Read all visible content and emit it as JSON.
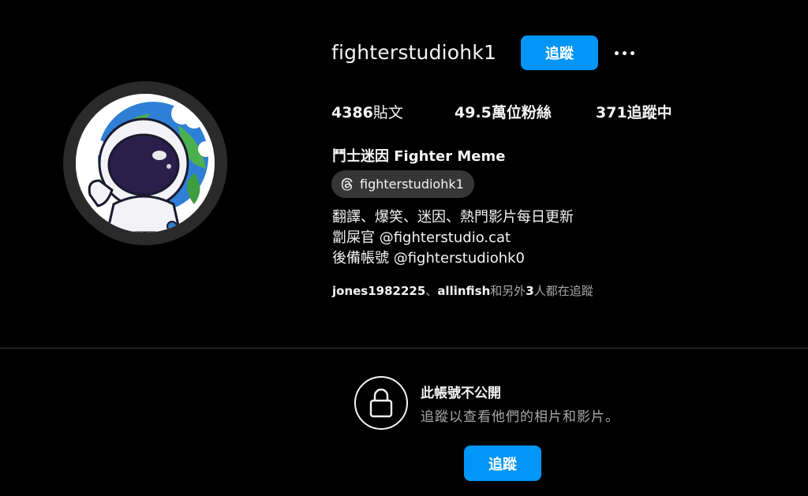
{
  "profile": {
    "username": "fighterstudiohk1",
    "follow_label": "追蹤",
    "more_icon": "more-horizontal-icon",
    "stats": {
      "posts_count": "4386",
      "posts_label": "貼文",
      "followers_count": "49.5萬位",
      "followers_label": "粉絲",
      "following_count": "371",
      "following_label": "追蹤中"
    },
    "full_name": "鬥士迷因 Fighter Meme",
    "threads": {
      "icon": "threads-icon",
      "handle": "fighterstudiohk1"
    },
    "bio": [
      "翻譯、爆笑、迷因、熱門影片每日更新",
      "劏屎官 @fighterstudio.cat",
      "後備帳號 @fighterstudiohk0"
    ],
    "followed_by": {
      "user1": "jones1982225",
      "separator": "、",
      "user2": "allinfish",
      "prefix": "和另外",
      "count": "3",
      "suffix": "人都在追蹤"
    }
  },
  "private": {
    "icon": "lock-icon",
    "title": "此帳號不公開",
    "subtitle": "追蹤以查看他們的相片和影片。",
    "follow_label": "追蹤"
  },
  "colors": {
    "background": "#000000",
    "accent": "#0095f6",
    "text": "#f5f5f5",
    "secondary_text": "#a8a8a8",
    "chip": "#363636"
  }
}
